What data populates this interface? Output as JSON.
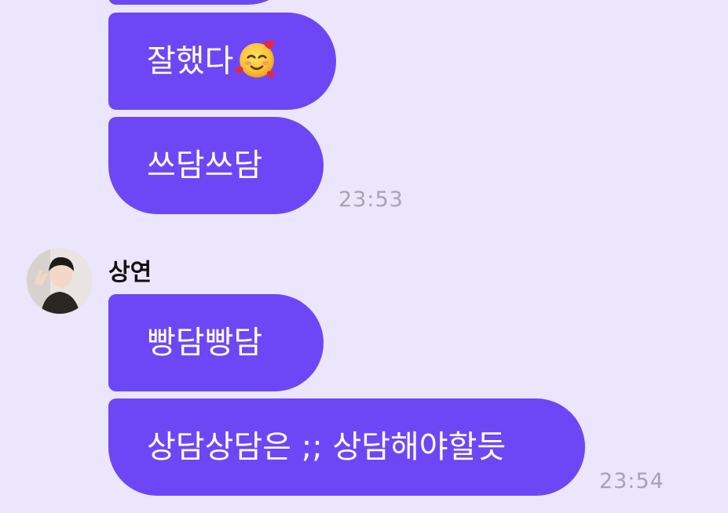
{
  "messages_top": [
    {
      "text": "잘했다",
      "emoji": "smiling-face-with-hearts-icon"
    },
    {
      "text": "쓰담쓰담"
    }
  ],
  "time_top": "23:53",
  "sender": {
    "name": "상연",
    "avatar": "person-avatar"
  },
  "messages_bottom": [
    {
      "text": "빵담빵담"
    },
    {
      "text": "상담상담은 ;; 상담해야할듯"
    }
  ],
  "time_bottom": "23:54",
  "colors": {
    "background": "#ebe6fb",
    "bubble": "#6d47f6",
    "bubble_text": "#ffffff",
    "timestamp": "#a6a3b2"
  }
}
